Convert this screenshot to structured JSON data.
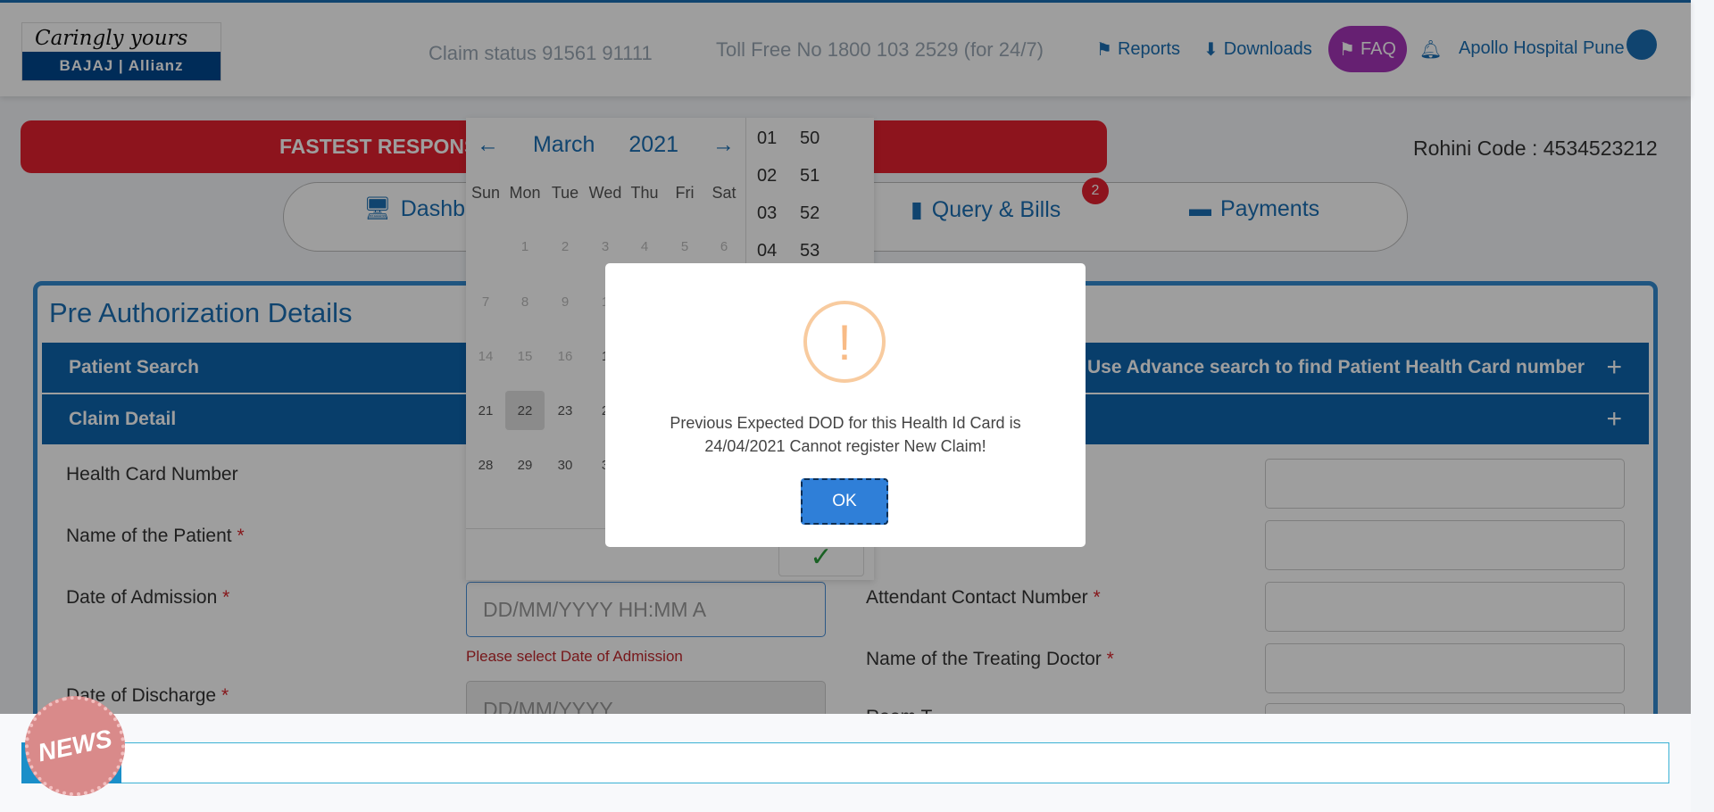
{
  "header": {
    "logo_tagline": "Caringly yours",
    "logo_brand": "BAJAJ | Allianz",
    "claim_status": "Claim status 91561 91111",
    "toll_free": "Toll Free No 1800 103 2529 (for 24/7)",
    "links": {
      "reports": "Reports",
      "downloads": "Downloads",
      "faq": "FAQ"
    },
    "user": "Apollo Hospital Pune"
  },
  "banner": {
    "text": "FASTEST RESPONSE"
  },
  "rohini_code": "Rohini Code : 4534523212",
  "nav": {
    "dashboard": "Dashb",
    "query_bills": "Query & Bills",
    "query_badge": "2",
    "payments": "Payments"
  },
  "form": {
    "title": "Pre Authorization Details",
    "patient_search": "Patient Search",
    "advance_search": "Use Advance search to find Patient Health Card number",
    "claim_detail": "Claim Detail",
    "fields": {
      "health_card": "Health Card Number",
      "patient_name": "Name of the Patient",
      "doa": "Date of Admission",
      "dod": "Date of Discharge",
      "attendant": "Attendant Contact Number",
      "doctor": "Name of the Treating Doctor",
      "room": "Room T"
    },
    "doa_placeholder": "DD/MM/YYYY HH:MM A",
    "dod_placeholder": "DD/MM/YYYY",
    "doa_error": "Please select Date of Admission",
    "required_mark": "*"
  },
  "calendar": {
    "prev": "←",
    "next": "→",
    "month": "March",
    "year": "2021",
    "dow": [
      "Sun",
      "Mon",
      "Tue",
      "Wed",
      "Thu",
      "Fri",
      "Sat"
    ],
    "rows": [
      [
        "",
        "1",
        "2",
        "3",
        "4",
        "5",
        "6"
      ],
      [
        "7",
        "8",
        "9",
        "1",
        "",
        "",
        ""
      ],
      [
        "14",
        "15",
        "16",
        "1",
        "",
        "",
        ""
      ],
      [
        "21",
        "22",
        "23",
        "2",
        "",
        "",
        ""
      ],
      [
        "28",
        "29",
        "30",
        "3",
        "",
        "",
        ""
      ]
    ],
    "selected": "22",
    "hours": [
      "01",
      "02",
      "03",
      "04"
    ],
    "minutes": [
      "50",
      "51",
      "52",
      "53"
    ]
  },
  "modal": {
    "icon": "!",
    "message": "Previous Expected DOD for this Health Id Card is 24/04/2021 Cannot register New Claim!",
    "ok": "OK"
  },
  "news": {
    "label": "NEWS"
  }
}
